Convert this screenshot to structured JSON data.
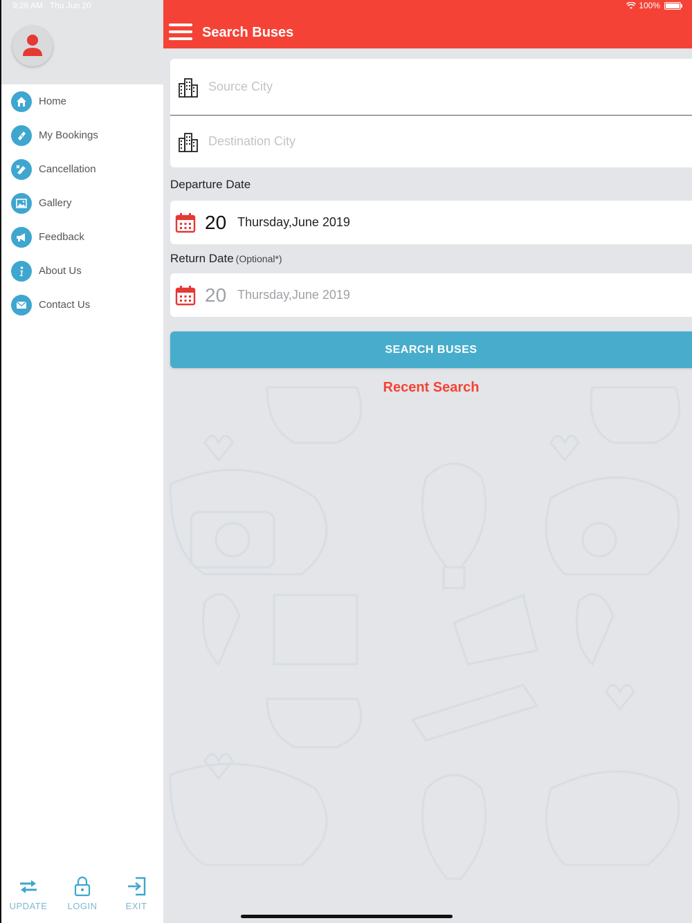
{
  "status_bar": {
    "time": "9:26 AM",
    "date": "Thu Jun 20",
    "battery": "100%"
  },
  "colors": {
    "accent": "#f44336",
    "primary": "#48adcc",
    "icon_blue": "#3ea6cf"
  },
  "drawer": {
    "items": [
      {
        "label": "Home",
        "icon": "home-icon"
      },
      {
        "label": "My Bookings",
        "icon": "ticket-icon"
      },
      {
        "label": "Cancellation",
        "icon": "cancel-icon"
      },
      {
        "label": "Gallery",
        "icon": "gallery-icon"
      },
      {
        "label": "Feedback",
        "icon": "megaphone-icon"
      },
      {
        "label": "About Us",
        "icon": "info-icon"
      },
      {
        "label": "Contact Us",
        "icon": "contact-icon"
      }
    ],
    "footer": [
      {
        "label": "UPDATE",
        "icon": "swap-arrows-icon"
      },
      {
        "label": "LOGIN",
        "icon": "lock-icon"
      },
      {
        "label": "EXIT",
        "icon": "exit-icon"
      }
    ]
  },
  "header": {
    "title": "Search Buses"
  },
  "form": {
    "source_placeholder": "Source City",
    "destination_placeholder": "Destination City",
    "departure_label": "Departure Date",
    "departure": {
      "day": "20",
      "text": "Thursday,June 2019"
    },
    "return_label": "Return Date",
    "return_optional": "(Optional*)",
    "return": {
      "day": "20",
      "text": "Thursday,June 2019"
    },
    "search_button": "SEARCH BUSES",
    "recent_search": "Recent Search"
  }
}
